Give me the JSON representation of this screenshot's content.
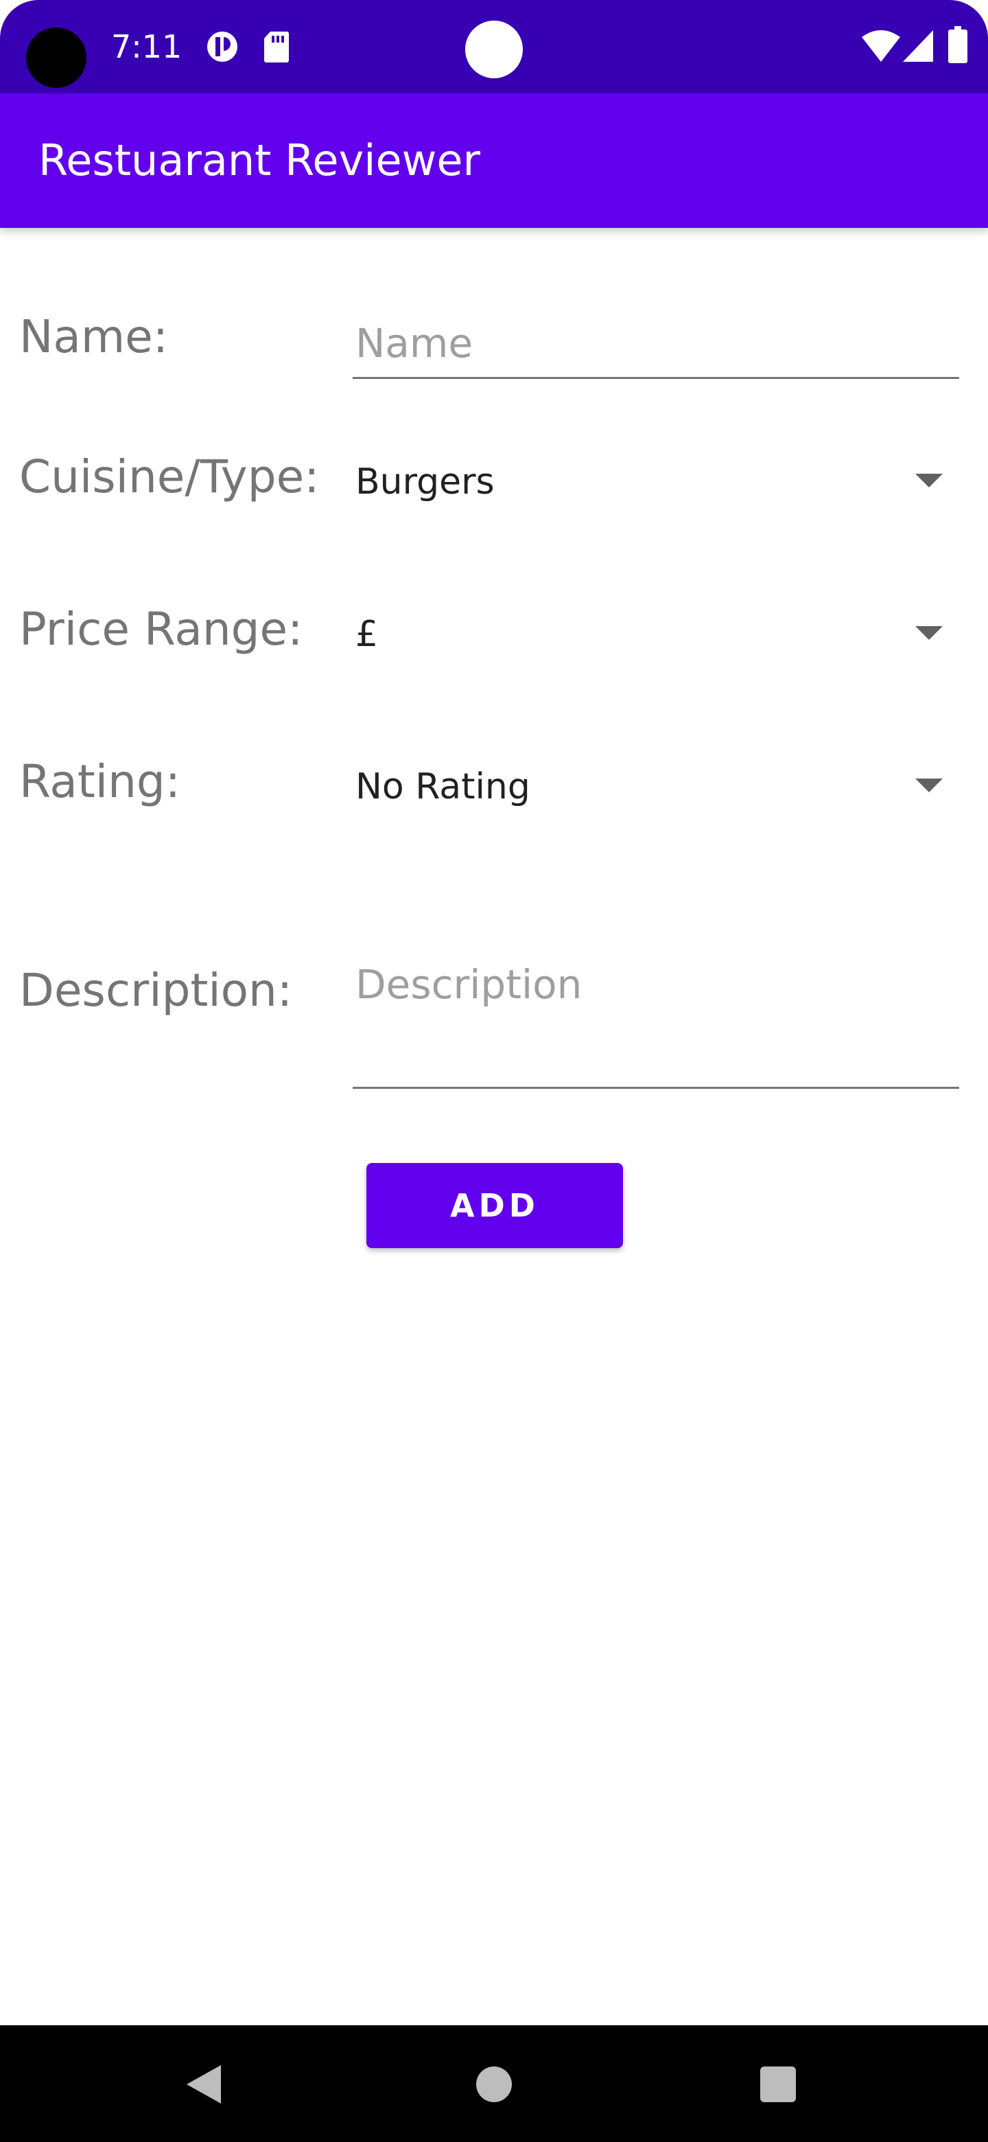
{
  "status_bar": {
    "time": "7:11",
    "icons": [
      "camera-hole",
      "data-saver-icon",
      "sd-card-icon",
      "wifi-icon",
      "signal-icon",
      "battery-icon"
    ]
  },
  "app_bar": {
    "title": "Restuarant Reviewer"
  },
  "form": {
    "name": {
      "label": "Name:",
      "placeholder": "Name",
      "value": ""
    },
    "cuisine": {
      "label": "Cuisine/Type:",
      "selected": "Burgers"
    },
    "price_range": {
      "label": "Price Range:",
      "selected": "£"
    },
    "rating": {
      "label": "Rating:",
      "selected": "No Rating"
    },
    "description": {
      "label": "Description:",
      "placeholder": "Description",
      "value": ""
    },
    "add_button_label": "ADD"
  },
  "colors": {
    "status_bar": "#3700b3",
    "primary": "#6200ee",
    "label_text": "#757575"
  }
}
